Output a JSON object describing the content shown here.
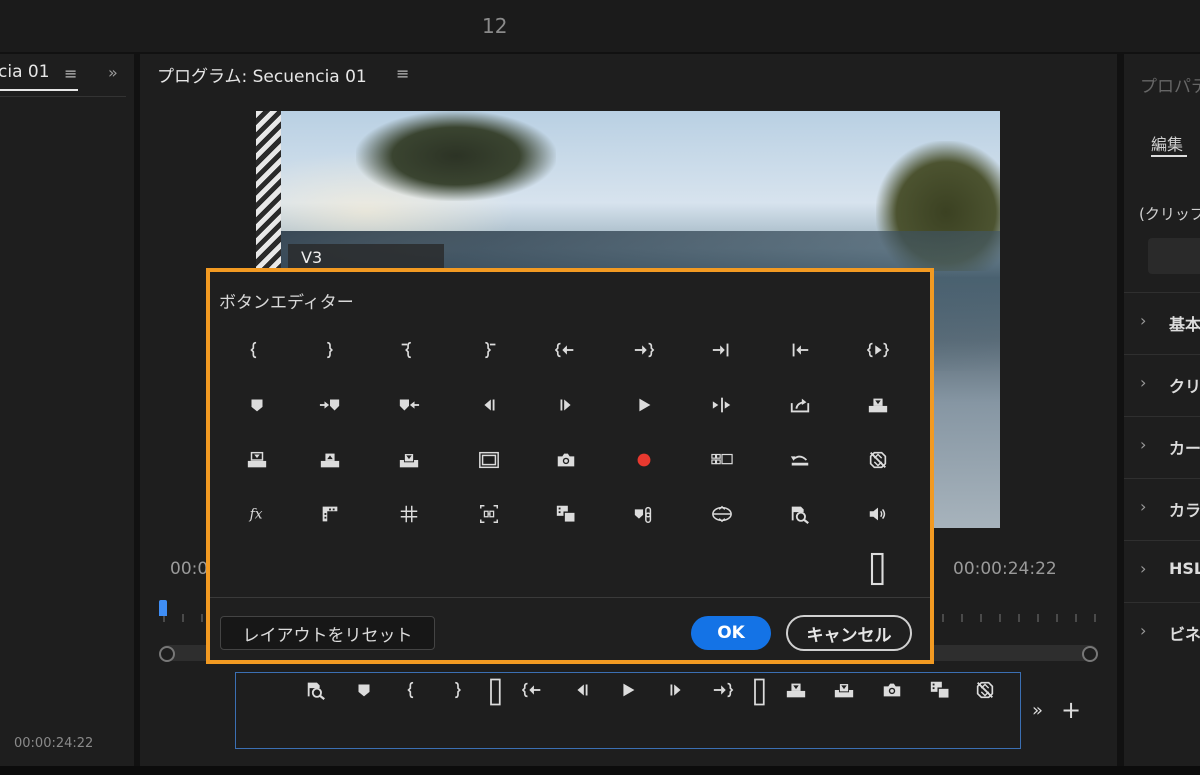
{
  "topbar": {
    "number": "12"
  },
  "left_panel": {
    "title": "cia 01",
    "menu_icon": "hamburger-menu-icon",
    "expand_icon": "double-chevron-icon",
    "timecode": "00:00:24:22"
  },
  "program_monitor": {
    "title": "プログラム: Secuencia 01",
    "menu_icon": "hamburger-menu-icon",
    "track_label": "V3",
    "timecode_left": "00:0",
    "timecode_right": "00:00:24:22"
  },
  "button_editor": {
    "title": "ボタンエディター",
    "icons": [
      [
        "mark-in-icon",
        "mark-out-icon",
        "clear-in-icon",
        "clear-out-icon",
        "go-to-in-icon",
        "go-to-out-icon",
        "go-to-next-edit-icon",
        "go-to-previous-edit-icon",
        "play-in-to-out-icon"
      ],
      [
        "add-marker-icon",
        "go-to-next-marker-icon",
        "go-to-previous-marker-icon",
        "step-back-icon",
        "step-forward-icon",
        "play-icon",
        "play-around-icon",
        "export-frame-icon",
        "insert-icon"
      ],
      [
        "lift-icon",
        "extract-icon",
        "overwrite-icon",
        "safe-margins-icon",
        "camera-icon",
        "record-icon",
        "multi-camera-icon",
        "loop-icon",
        "toggle-proxies-icon"
      ],
      [
        "fx-icon",
        "trim-icon",
        "grid-icon",
        "fit-icon",
        "comparison-view-icon",
        "add-marker-link-icon",
        "vr-video-icon",
        "zoom-icon",
        "volume-icon"
      ],
      [
        "",
        "",
        "",
        "",
        "",
        "",
        "",
        "",
        "spacer-icon"
      ]
    ],
    "reset_label": "レイアウトをリセット",
    "ok_label": "OK",
    "cancel_label": "キャンセル"
  },
  "button_bar": {
    "icons": [
      "zoom-icon",
      "add-marker-icon",
      "mark-in-icon",
      "mark-out-icon",
      "spacer-icon",
      "go-to-in-icon",
      "step-back-icon",
      "play-icon",
      "step-forward-icon",
      "go-to-out-icon",
      "spacer-icon",
      "insert-icon",
      "overwrite-icon",
      "camera-icon",
      "comparison-view-icon",
      "toggle-proxies-icon"
    ],
    "more_label": "»",
    "add_label": "+"
  },
  "properties_panel": {
    "title": "プロパテ",
    "tab": "編集",
    "clip_label": "(クリップ",
    "sections": [
      "基本",
      "クリ",
      "カー",
      "カラ",
      "HSL",
      "ビネ"
    ]
  },
  "colors": {
    "accent_orange": "#f29a22",
    "ok_blue": "#1473e6",
    "record_red": "#e8392f",
    "playhead_blue": "#3f8ef5"
  }
}
